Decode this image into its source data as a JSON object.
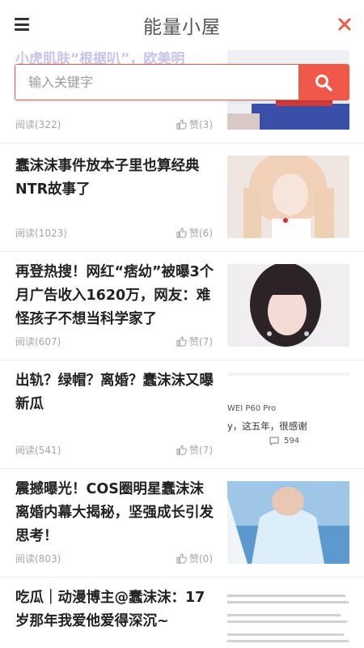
{
  "header": {
    "title": "能量小屋"
  },
  "search": {
    "placeholder": "输入关键字"
  },
  "top_partial": {
    "title_fragment": "小虎肌肤“根据叭”，欧美明",
    "reads": "阅读(322)",
    "likes": "赞(3)"
  },
  "articles": [
    {
      "title": "蠢沫沫事件放本子里也算经典NTR故事了",
      "reads": "阅读(1023)",
      "likes": "赞(6)"
    },
    {
      "title": "再登热搜！网红“痞幼”被曝3个月广告收入1620万，网友：难怪孩子不想当科学家了",
      "reads": "阅读(607)",
      "likes": "赞(7)"
    },
    {
      "title": "出轨？绿帽？离婚？蠢沫沫又曝新瓜",
      "reads": "阅读(541)",
      "likes": "赞(7)",
      "thumb_text": {
        "line1": "WEI P60 Pro",
        "line2": "y，这五年，很感谢",
        "count": "594"
      }
    },
    {
      "title": "震撼曝光！COS圈明星蠢沫沫离婚内幕大揭秘，坚强成长引发思考！",
      "reads": "阅读(803)",
      "likes": "赞(0)"
    },
    {
      "title": "吃瓜｜动漫博主@蠢沫沫：17岁那年我爱他爱得深沉~",
      "reads": "",
      "likes": ""
    }
  ],
  "colors": {
    "accent": "#f0594a",
    "close": "#e8594b",
    "meta": "#a5a5a5"
  },
  "icons": {
    "menu": "hamburger-menu-icon",
    "close": "close-icon",
    "search": "search-icon",
    "like": "thumbs-up-icon",
    "comment": "comment-icon"
  }
}
